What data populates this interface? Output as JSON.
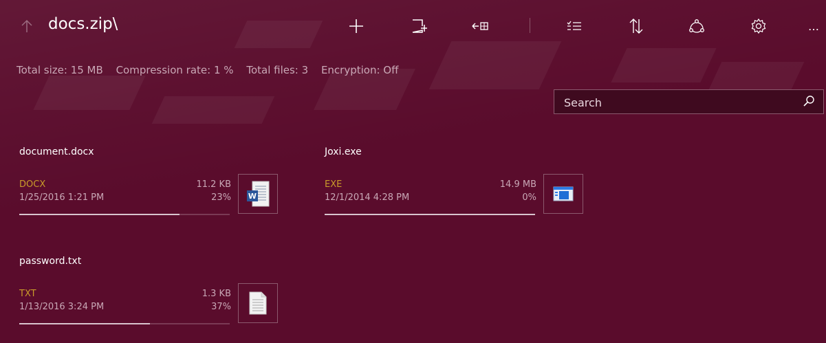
{
  "header": {
    "title": "docs.zip\\",
    "toolbar_icons": [
      "up-arrow-icon",
      "add-icon",
      "new-item-icon",
      "extract-icon",
      "select-all-icon",
      "sort-icon",
      "share-icon",
      "settings-icon",
      "more-icon"
    ],
    "more_label": "…"
  },
  "info": {
    "total_size": "Total size: 15 MB",
    "compression_rate": "Compression rate: 1 %",
    "total_files": "Total files: 3",
    "encryption": "Encryption: Off"
  },
  "search": {
    "placeholder": "Search"
  },
  "files": [
    {
      "name": "document.docx",
      "type": "DOCX",
      "date": "1/25/2016 1:21 PM",
      "size": "11.2 KB",
      "percent": "23%",
      "progress": 0.76,
      "icon": "word-document-icon"
    },
    {
      "name": "Joxi.exe",
      "type": "EXE",
      "date": "12/1/2014 4:28 PM",
      "size": "14.9 MB",
      "percent": "0%",
      "progress": 1.0,
      "icon": "application-icon"
    },
    {
      "name": "password.txt",
      "type": "TXT",
      "date": "1/13/2016 3:24 PM",
      "size": "1.3 KB",
      "percent": "37%",
      "progress": 0.62,
      "icon": "text-file-icon"
    }
  ],
  "colors": {
    "background": "#5a0c2c",
    "type_accent": "#c99c2a"
  }
}
